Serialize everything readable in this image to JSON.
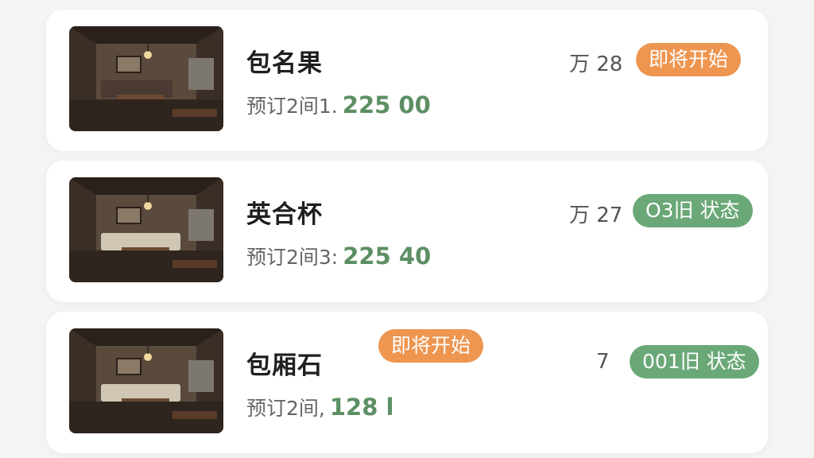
{
  "rooms": [
    {
      "title": "包名果",
      "subtitle": "预订2间1.",
      "price": "225 00",
      "date": "万 28",
      "badge": "即将开始",
      "badge_color": "#ee9550"
    },
    {
      "title": "英合杯",
      "subtitle": "预订2间3:",
      "price": "225 40",
      "date": "万 27",
      "badge": "O3旧 状态",
      "badge_color": "#6aa878"
    },
    {
      "title": "包厢石",
      "subtitle": "预订2间,",
      "price": "128 l",
      "date": "7",
      "badge": "001旧 状态",
      "badge_color": "#6aa878",
      "extra_badge": "即将开始",
      "extra_badge_color": "#ee9550"
    }
  ]
}
